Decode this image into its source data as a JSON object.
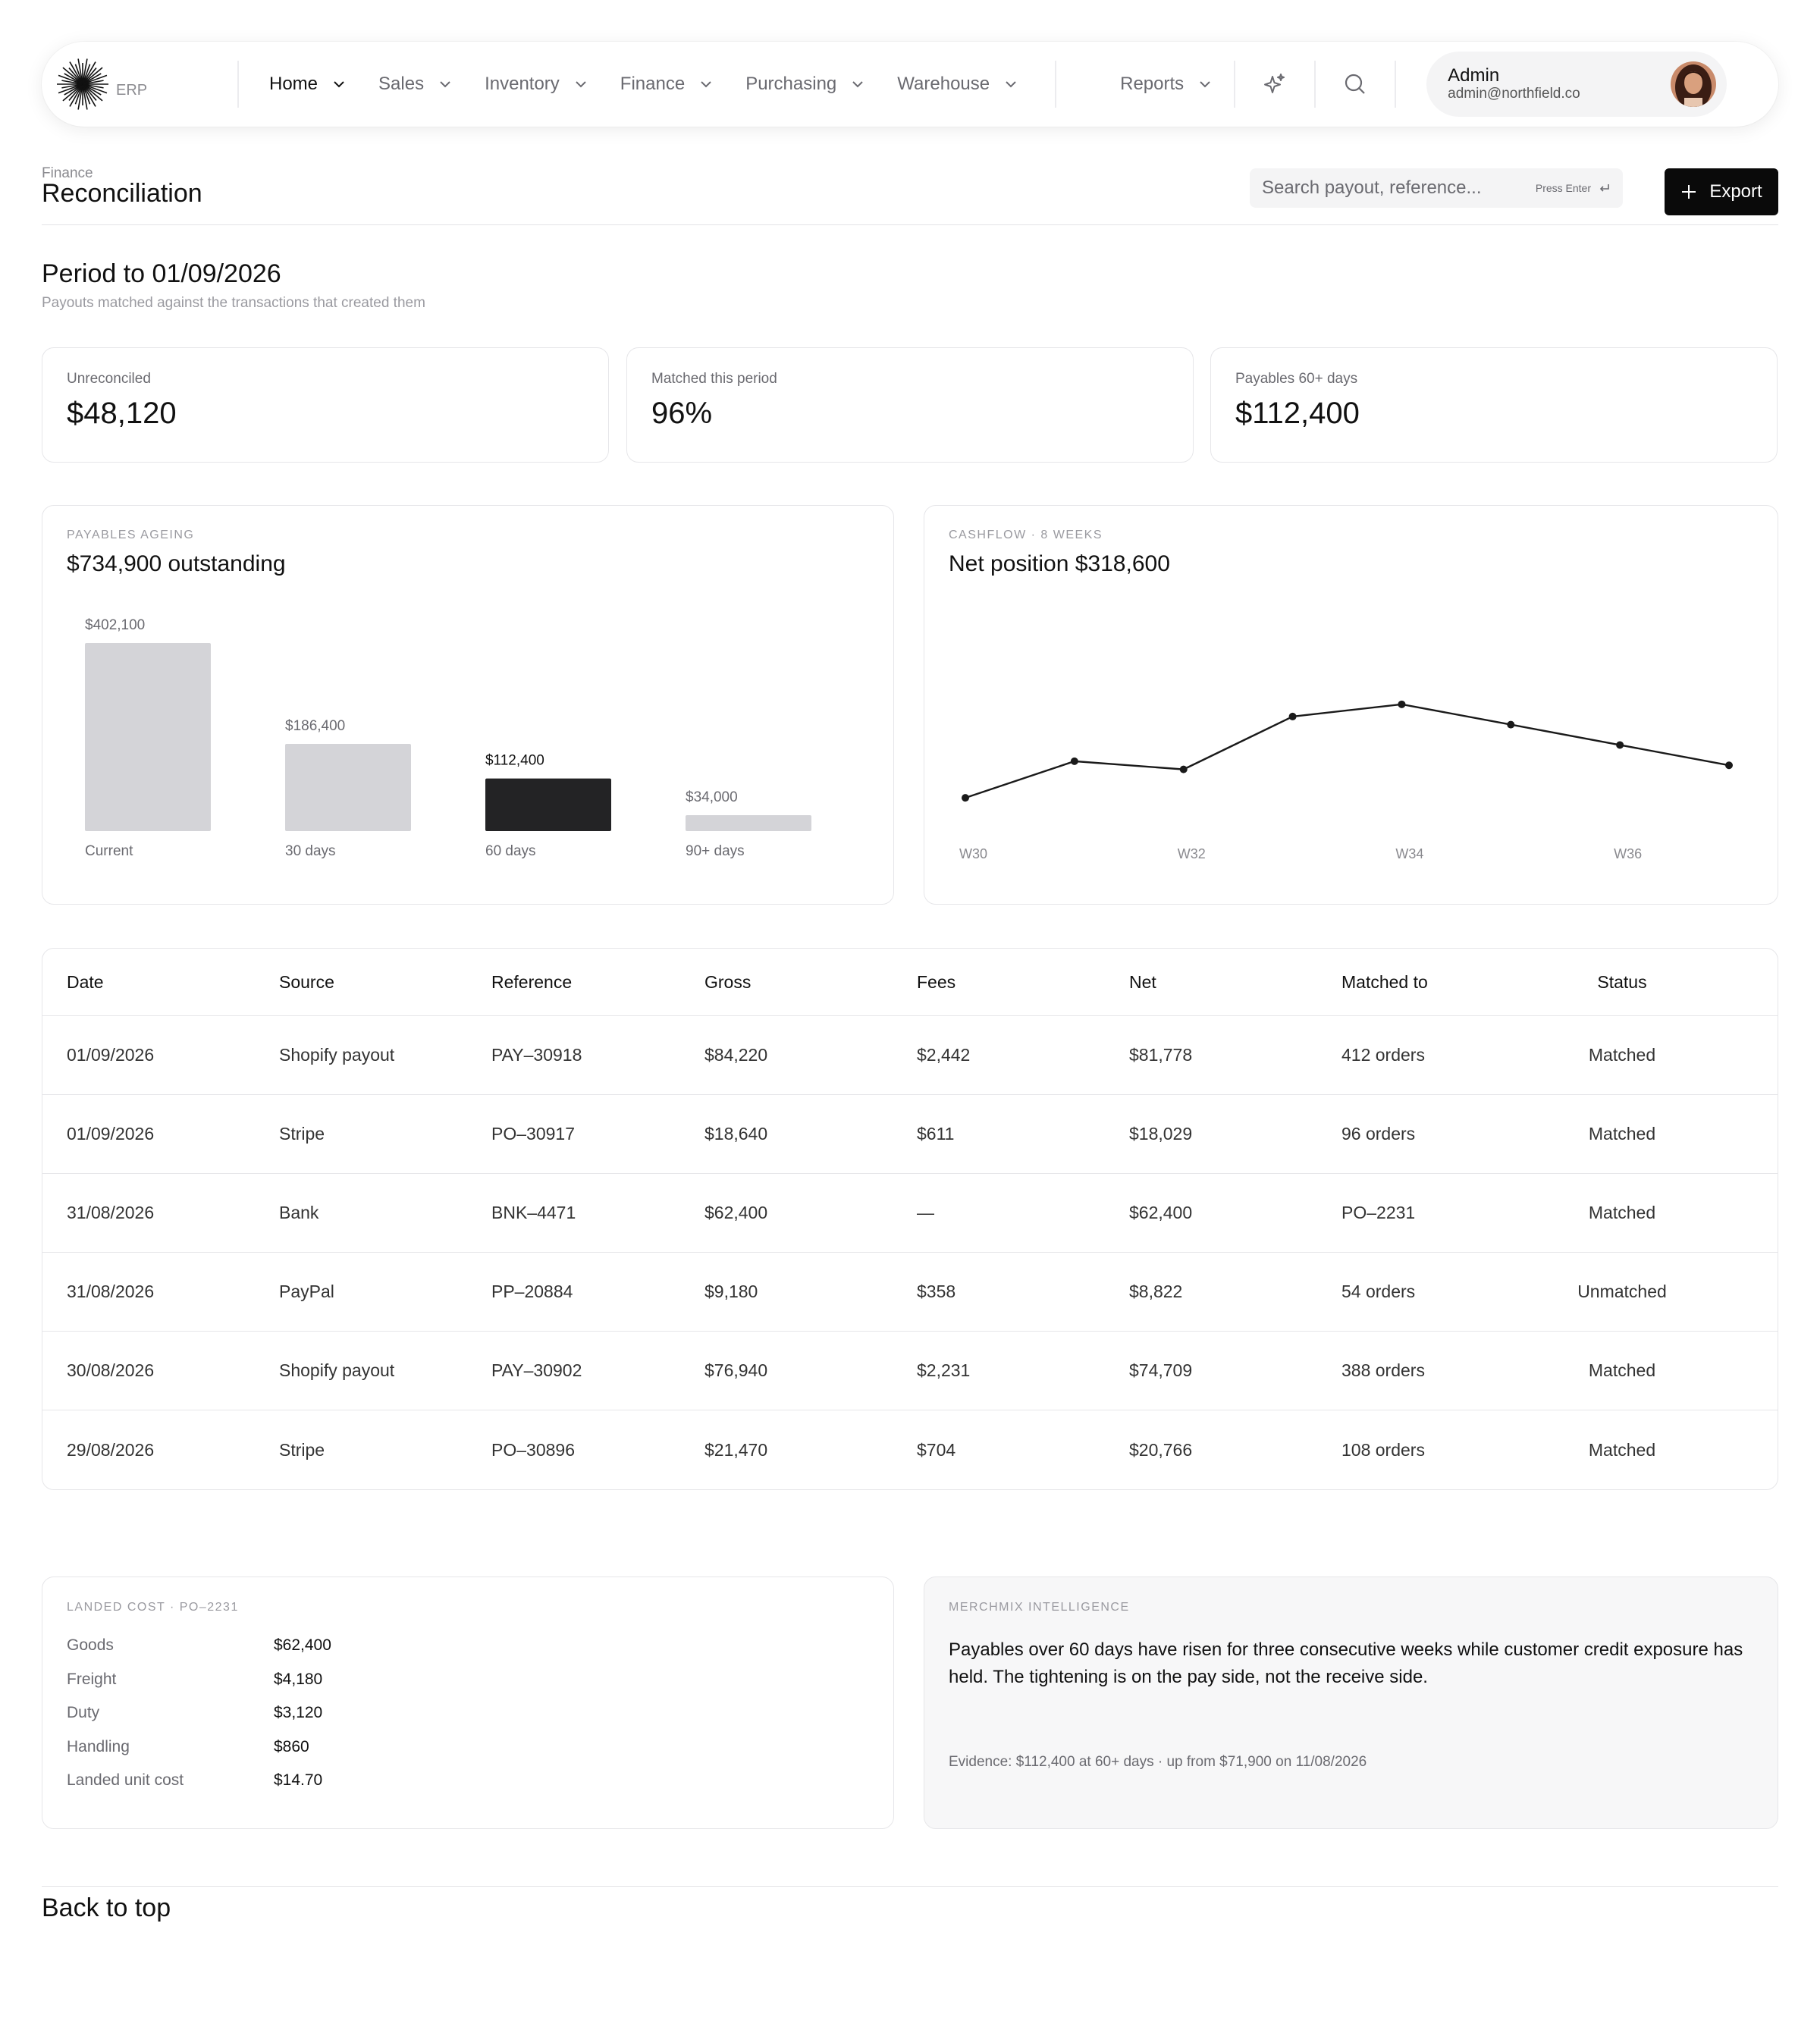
{
  "nav": {
    "logo_text": "ERP",
    "items": [
      {
        "label": "Home",
        "active": true
      },
      {
        "label": "Sales"
      },
      {
        "label": "Inventory"
      },
      {
        "label": "Finance"
      },
      {
        "label": "Purchasing"
      },
      {
        "label": "Warehouse"
      },
      {
        "label": "Reports"
      }
    ],
    "icons": [
      "sparkle-icon",
      "search-icon"
    ],
    "profile": {
      "name": "Admin",
      "email": "admin@northfield.co"
    }
  },
  "header": {
    "breadcrumb": "Finance",
    "title": "Reconciliation",
    "search_placeholder": "Search payout, reference...",
    "search_hint": "Press Enter",
    "export_label": "Export"
  },
  "period": {
    "title": "Period to 01/09/2026",
    "subtitle": "Payouts matched against the transactions that created them"
  },
  "kpis": [
    {
      "label": "Unreconciled",
      "value": "$48,120"
    },
    {
      "label": "Matched this period",
      "value": "96%"
    },
    {
      "label": "Payables 60+ days",
      "value": "$112,400"
    }
  ],
  "ageing": {
    "kicker": "PAYABLES AGEING",
    "title": "$734,900 outstanding"
  },
  "cashflow": {
    "kicker": "CASHFLOW · 8 WEEKS",
    "title": "Net position $318,600"
  },
  "chart_data": [
    {
      "type": "bar",
      "categories": [
        "Current",
        "30 days",
        "60 days",
        "90+ days"
      ],
      "values": [
        402100,
        186400,
        112400,
        34000
      ],
      "value_labels": [
        "$402,100",
        "$186,400",
        "$112,400",
        "$34,000"
      ],
      "highlight_index": 2,
      "colors": {
        "bar": "#d4d4d8",
        "highlight": "#232325"
      }
    },
    {
      "type": "line",
      "x": [
        "W30",
        "W31",
        "W32",
        "W33",
        "W34",
        "W35",
        "W36",
        "W37"
      ],
      "x_tick_labels": [
        "W30",
        "W32",
        "W34",
        "W36"
      ],
      "values_relative": [
        0.16,
        0.34,
        0.3,
        0.56,
        0.62,
        0.52,
        0.42,
        0.32
      ],
      "ylim": [
        0,
        1
      ],
      "grid": false,
      "color": "#1a1a1a"
    }
  ],
  "table": {
    "columns": [
      "Date",
      "Source",
      "Reference",
      "Gross",
      "Fees",
      "Net",
      "Matched to",
      "Status"
    ],
    "rows": [
      [
        "01/09/2026",
        "Shopify payout",
        "PAY–30918",
        "$84,220",
        "$2,442",
        "$81,778",
        "412 orders",
        "Matched"
      ],
      [
        "01/09/2026",
        "Stripe",
        "PO–30917",
        "$18,640",
        "$611",
        "$18,029",
        "96 orders",
        "Matched"
      ],
      [
        "31/08/2026",
        "Bank",
        "BNK–4471",
        "$62,400",
        "—",
        "$62,400",
        "PO–2231",
        "Matched"
      ],
      [
        "31/08/2026",
        "PayPal",
        "PP–20884",
        "$9,180",
        "$358",
        "$8,822",
        "54 orders",
        "Unmatched"
      ],
      [
        "30/08/2026",
        "Shopify payout",
        "PAY–30902",
        "$76,940",
        "$2,231",
        "$74,709",
        "388 orders",
        "Matched"
      ],
      [
        "29/08/2026",
        "Stripe",
        "PO–30896",
        "$21,470",
        "$704",
        "$20,766",
        "108 orders",
        "Matched"
      ]
    ]
  },
  "landed": {
    "kicker": "LANDED COST · PO–2231",
    "rows": [
      {
        "label": "Goods",
        "value": "$62,400"
      },
      {
        "label": "Freight",
        "value": "$4,180"
      },
      {
        "label": "Duty",
        "value": "$3,120"
      },
      {
        "label": "Handling",
        "value": "$860"
      },
      {
        "label": "Landed unit cost",
        "value": "$14.70"
      }
    ]
  },
  "intelligence": {
    "kicker": "MERCHMIX INTELLIGENCE",
    "text": "Payables over 60 days have risen for three consecutive weeks while customer credit exposure has held. The tightening is on the pay side, not the receive side.",
    "evidence": "Evidence: $112,400 at 60+ days · up from $71,900 on 11/08/2026"
  },
  "footer": {
    "back_to_top": "Back to top"
  }
}
